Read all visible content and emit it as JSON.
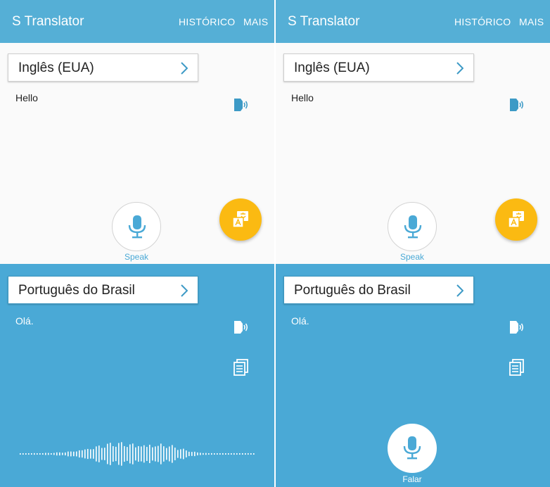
{
  "app": {
    "title": "S Translator",
    "menu_historico": "HISTÓRICO",
    "menu_mais": "MAIS"
  },
  "colors": {
    "header": "#55afd6",
    "target_panel": "#4aa9d6",
    "fab": "#fbba12"
  },
  "left_panel": {
    "source_language": "Inglês (EUA)",
    "source_text": "Hello",
    "speak_label": "Speak",
    "target_language": "Português do Brasil",
    "target_text": "Olá."
  },
  "right_panel": {
    "source_language": "Inglês (EUA)",
    "source_text": "Hello",
    "speak_label": "Speak",
    "target_language": "Português do Brasil",
    "target_text": "Olá.",
    "speak_target_label": "Falar"
  },
  "icons": {
    "chevron": "chevron-right-icon",
    "tts": "speaker-icon",
    "copy": "copy-icon",
    "mic": "microphone-icon",
    "swap": "translate-swap-icon",
    "waveform": "audio-waveform-icon"
  }
}
